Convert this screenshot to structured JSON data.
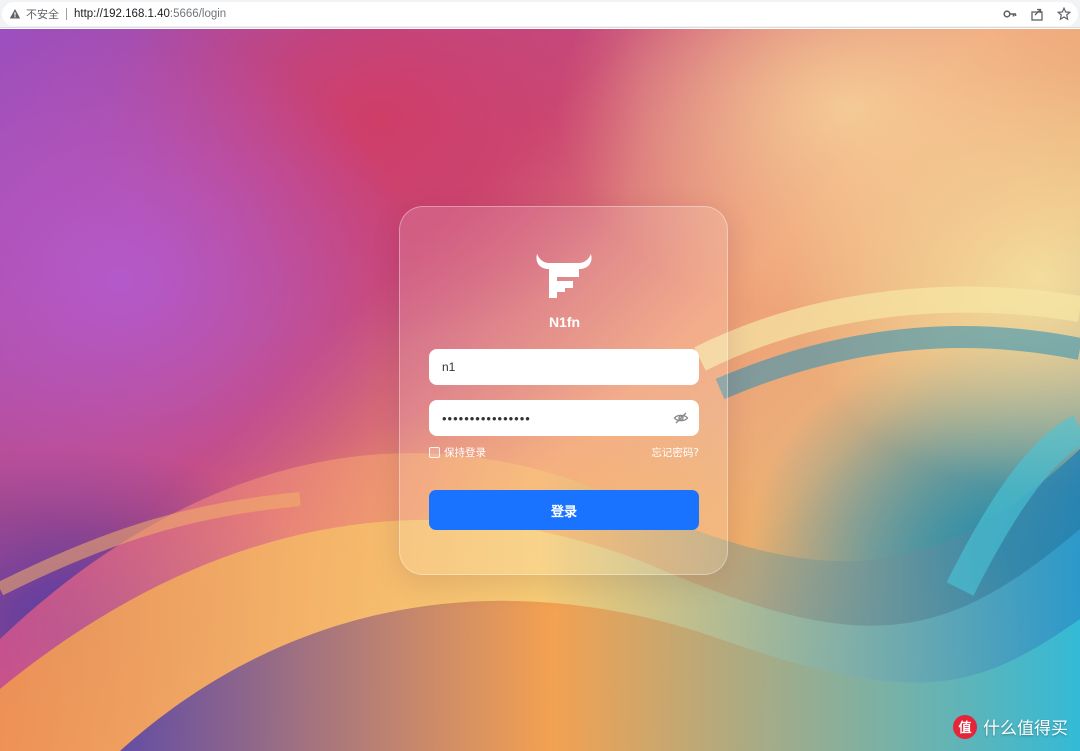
{
  "browser": {
    "security_label": "不安全",
    "url_host": "http://192.168.1.40",
    "url_rest": ":5666/login",
    "icons": [
      "warning-icon",
      "key-icon",
      "share-icon",
      "star-icon"
    ]
  },
  "login": {
    "brand_name": "N1fn",
    "username_value": "n1",
    "password_value": "••••••••••••••••",
    "remember_label": "保持登录",
    "remember_checked": false,
    "forgot_label": "忘记密码?",
    "submit_label": "登录"
  },
  "colors": {
    "primary_button": "#1a73ff",
    "field_background": "#ffffff",
    "watermark_badge": "#e5263a"
  },
  "watermark": {
    "badge_text": "值",
    "text": "什么值得买"
  }
}
